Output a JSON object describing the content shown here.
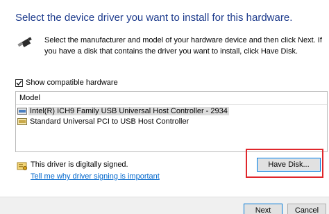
{
  "header": {
    "title": "Select the device driver you want to install for this hardware."
  },
  "description": "Select the manufacturer and model of your hardware device and then click Next. If you have a disk that contains the driver you want to install, click Have Disk.",
  "compatible": {
    "label": "Show compatible hardware",
    "checked": true
  },
  "model_list": {
    "header": "Model",
    "items": [
      {
        "label": "Intel(R) ICH9 Family USB Universal Host Controller - 2934",
        "selected": true,
        "icon": "usb-device-icon"
      },
      {
        "label": "Standard Universal PCI to USB Host Controller",
        "selected": false,
        "icon": "usb-device-icon"
      }
    ]
  },
  "signing": {
    "status": "This driver is digitally signed.",
    "link": "Tell me why driver signing is important",
    "icon": "signed-driver-icon"
  },
  "buttons": {
    "have_disk": "Have Disk...",
    "next": "Next",
    "cancel": "Cancel"
  },
  "colors": {
    "title": "#1c3a8c",
    "link": "#0066cc",
    "highlight": "#e0262b",
    "focus": "#0078d7"
  }
}
